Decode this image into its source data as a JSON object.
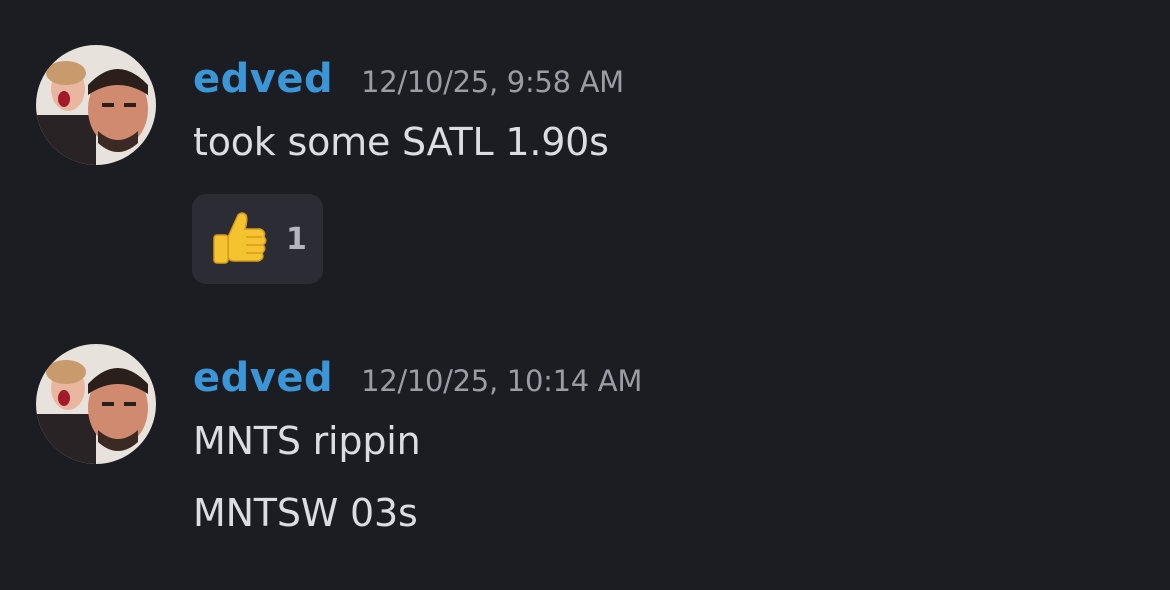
{
  "messages": [
    {
      "username": "edved",
      "timestamp": "12/10/25, 9:58 AM",
      "lines": [
        "took some SATL 1.90s"
      ],
      "reaction": {
        "emoji": "thumbs-up",
        "count": "1"
      }
    },
    {
      "username": "edved",
      "timestamp": "12/10/25, 10:14 AM",
      "lines": [
        "MNTS rippin",
        "MNTSW 03s"
      ]
    }
  ],
  "colors": {
    "background": "#1c1d22",
    "username": "#3b96d8",
    "timestamp": "#9b9ca6",
    "message_text": "#dcdde2",
    "reaction_bg": "#2c2d34"
  }
}
